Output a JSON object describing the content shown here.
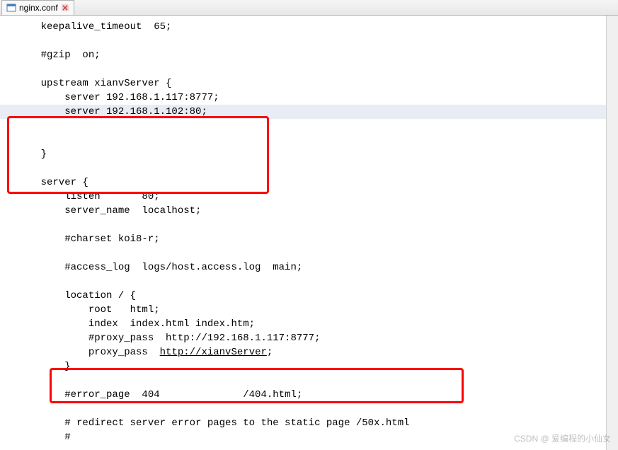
{
  "tab": {
    "filename": "nginx.conf"
  },
  "code": {
    "l1": "    keepalive_timeout  65;",
    "l2": "",
    "l3": "    #gzip  on;",
    "l4": "",
    "l5": "    upstream xianvServer {",
    "l6": "        server 192.168.1.117:8777;",
    "l7": "        server 192.168.1.102:80;",
    "l8": "",
    "l9": "",
    "l10": "    }",
    "l11": "",
    "l12": "    server {",
    "l13": "        listen       80;",
    "l14": "        server_name  localhost;",
    "l15": "",
    "l16": "        #charset koi8-r;",
    "l17": "",
    "l18": "        #access_log  logs/host.access.log  main;",
    "l19": "",
    "l20": "        location / {",
    "l21": "            root   html;",
    "l22": "            index  index.html index.htm;",
    "l23": "            #proxy_pass  http://192.168.1.117:8777;",
    "l24a": "            proxy_pass  ",
    "l24b": "http://xianvServer",
    "l24c": ";",
    "l25": "        }",
    "l26": "",
    "l27": "        #error_page  404              /404.html;",
    "l28": "",
    "l29": "        # redirect server error pages to the static page /50x.html",
    "l30": "        #"
  },
  "watermark": "CSDN @ 爱编程的小仙女"
}
